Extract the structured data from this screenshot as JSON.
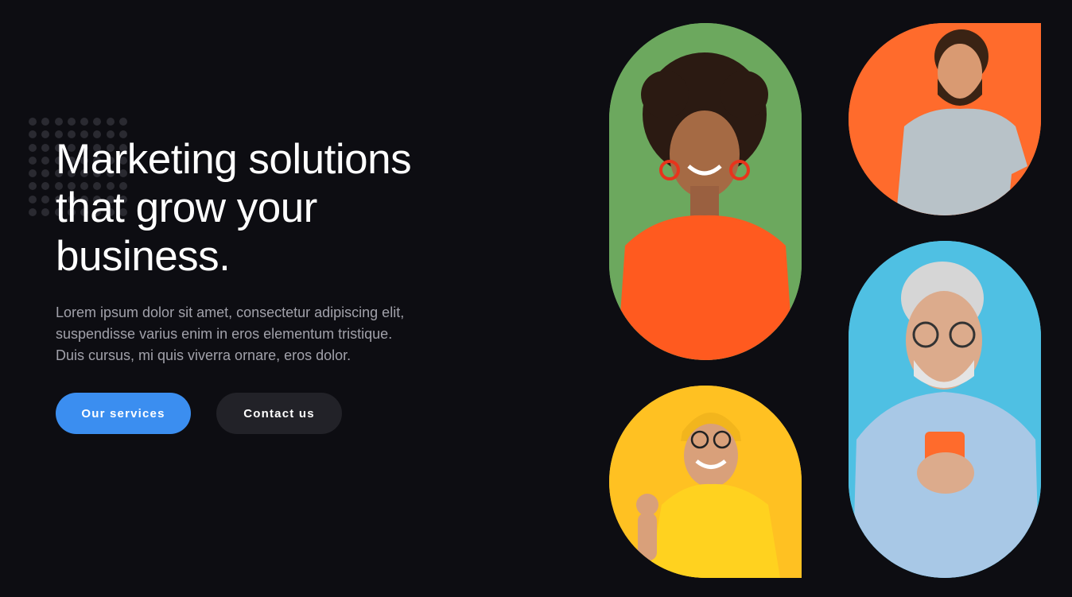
{
  "hero": {
    "title_line1": "Marketing solutions",
    "title_line2": "that grow your",
    "title_line3": "business.",
    "description_line1": "Lorem ipsum dolor sit amet, consectetur adipiscing elit,",
    "description_line2": "suspendisse varius enim in eros elementum tristique.",
    "description_line3": "Duis cursus, mi quis viverra ornare, eros dolor."
  },
  "buttons": {
    "primary_label": "Our services",
    "secondary_label": "Contact us"
  },
  "photos": [
    {
      "background": "#6ca85e",
      "clothing": "#ff5a1f",
      "description": "woman-orange-sweater"
    },
    {
      "background": "#ff6b2c",
      "clothing": "#b8c2c8",
      "description": "man-grey-tshirt"
    },
    {
      "background": "#ffc122",
      "clothing": "#ffd21f",
      "description": "man-yellow-beanie"
    },
    {
      "background": "#4fc0e3",
      "clothing": "#a8c8e6",
      "description": "older-man-blue-sweater-phone"
    }
  ],
  "colors": {
    "page_background": "#0d0d12",
    "accent": "#3b8ef0",
    "secondary_button": "#222228",
    "muted_text": "#a1a1aa"
  }
}
